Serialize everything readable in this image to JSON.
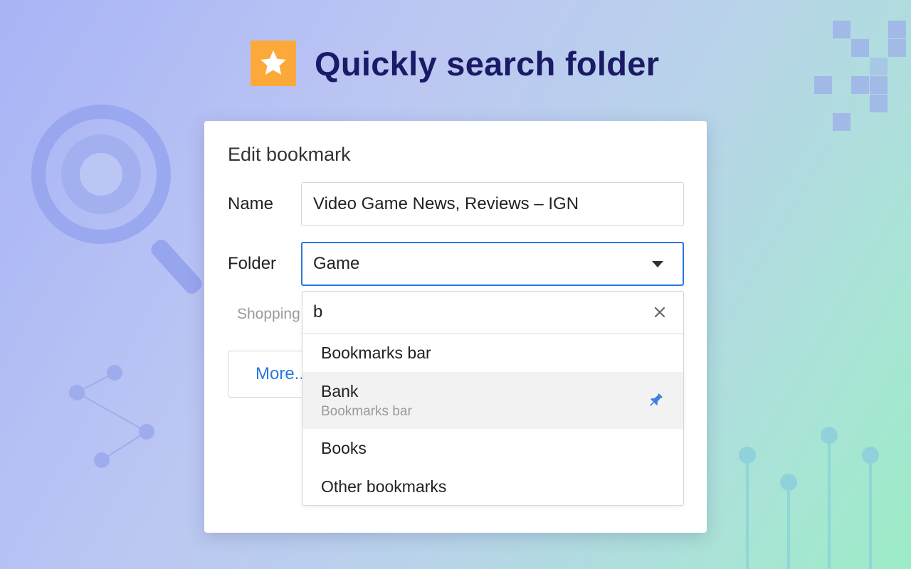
{
  "headline": {
    "text": "Quickly search folder",
    "badge_icon": "star-icon",
    "badge_color": "#fba93b"
  },
  "dialog": {
    "title": "Edit bookmark",
    "name_label": "Name",
    "name_value": "Video Game News, Reviews – IGN",
    "folder_label": "Folder",
    "folder_value": "Game",
    "behind_folder_text": "Shopping",
    "more_button_label": "More..."
  },
  "folder_dropdown": {
    "search_value": "b",
    "options": [
      {
        "label": "Bookmarks bar",
        "path": ""
      },
      {
        "label": "Bank",
        "path": "Bookmarks bar",
        "highlighted": true,
        "icon": "pin-icon"
      },
      {
        "label": "Books",
        "path": ""
      },
      {
        "label": "Other bookmarks",
        "path": ""
      }
    ]
  },
  "colors": {
    "accent": "#2a78dd",
    "headline": "#1a1a66",
    "highlight_row": "#f2f2f2"
  }
}
